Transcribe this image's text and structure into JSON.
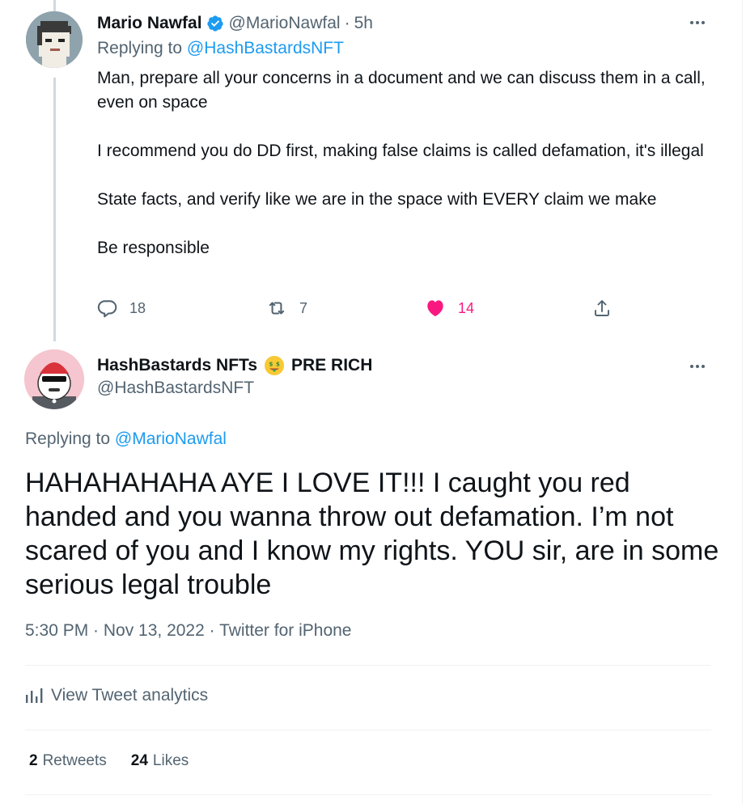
{
  "parent_tweet": {
    "author_name": "Mario Nawfal",
    "handle": "@MarioNawfal",
    "separator": "·",
    "time": "5h",
    "replying_prefix": "Replying to",
    "replying_to": "@HashBastardsNFT",
    "paragraphs": [
      "Man, prepare all your concerns in a document and we can discuss them in a call, even on space",
      "I recommend you do DD first, making false claims is called defamation, it's illegal",
      "State facts, and verify like we are in the space with EVERY claim we make",
      "Be responsible"
    ],
    "reply_count": "18",
    "retweet_count": "7",
    "like_count": "14"
  },
  "main_tweet": {
    "author_name": "HashBastards NFTs",
    "name_suffix": "PRE RICH",
    "handle": "@HashBastardsNFT",
    "replying_prefix": "Replying to",
    "replying_to": "@MarioNawfal",
    "text": "HAHAHAHAHA AYE I LOVE IT!!! I caught you red handed and you wanna throw out defamation. I’m not scared of you and I know my rights. YOU sir, are in some serious legal trouble",
    "meta": "5:30 PM · Nov 13, 2022 · Twitter for iPhone",
    "analytics_label": "View Tweet analytics",
    "retweets_count": "2",
    "retweets_label": "Retweets",
    "likes_count": "24",
    "likes_label": "Likes"
  },
  "colors": {
    "accent": "#1d9bf0",
    "like": "#f91880",
    "secondary_text": "#536471",
    "primary_text": "#0f1419"
  },
  "icons": [
    "verified-badge-icon",
    "more-icon",
    "reply-icon",
    "retweet-icon",
    "like-heart-icon",
    "share-icon",
    "money-mouth-emoji-icon",
    "analytics-bars-icon"
  ]
}
